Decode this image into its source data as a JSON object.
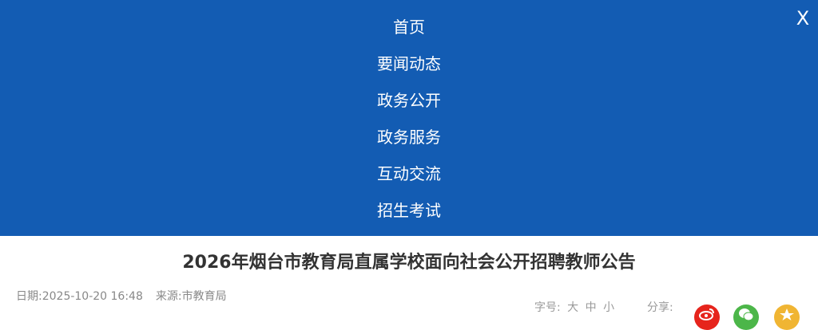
{
  "nav": {
    "items": [
      {
        "label": "首页"
      },
      {
        "label": "要闻动态"
      },
      {
        "label": "政务公开"
      },
      {
        "label": "政务服务"
      },
      {
        "label": "互动交流"
      },
      {
        "label": "招生考试"
      }
    ],
    "close_label": "X"
  },
  "article": {
    "title": "2026年烟台市教育局直属学校面向社会公开招聘教师公告",
    "date": "日期:2025-10-20 16:48",
    "source": "来源:市教育局"
  },
  "font_size": {
    "label": "字号:",
    "options": [
      "大",
      "中",
      "小"
    ]
  },
  "share": {
    "label": "分享:",
    "icons": [
      "weibo-icon",
      "wechat-icon",
      "qzone-icon"
    ]
  },
  "colors": {
    "nav_background": "#135cb3",
    "title_text": "#333333",
    "meta_text": "#888888",
    "weibo": "#e6241c",
    "wechat": "#4cb649",
    "qzone": "#f0b533"
  }
}
